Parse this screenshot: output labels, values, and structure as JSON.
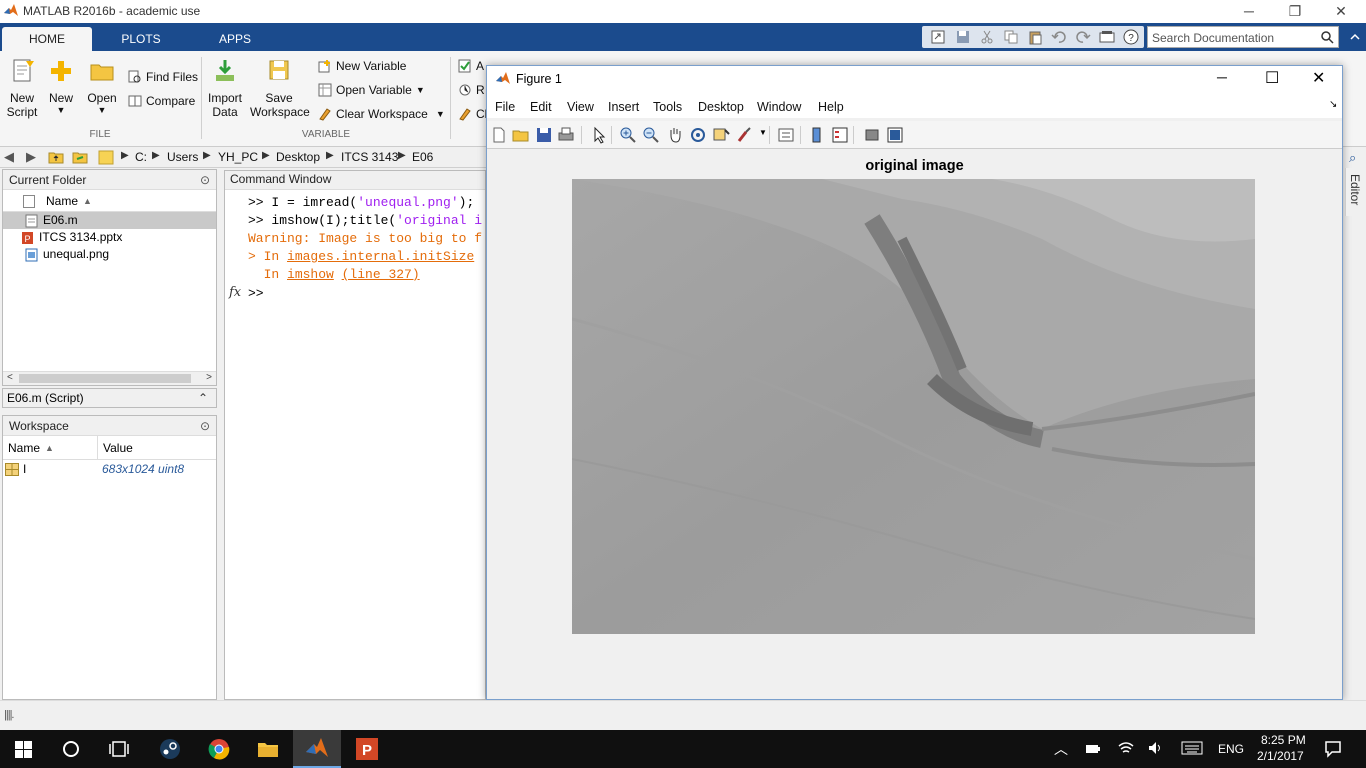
{
  "window": {
    "title": "MATLAB R2016b - academic use",
    "controls": [
      "─",
      "❐",
      "✕"
    ]
  },
  "ribbon": {
    "tabs": [
      "HOME",
      "PLOTS",
      "APPS"
    ],
    "active_tab": "HOME",
    "search_placeholder": "Search Documentation",
    "file_group": {
      "label": "FILE",
      "new_script": [
        "New",
        "Script"
      ],
      "new": "New",
      "open": "Open",
      "find_files": "Find Files",
      "compare": "Compare"
    },
    "variable_group": {
      "label": "VARIABLE",
      "import_data": [
        "Import",
        "Data"
      ],
      "save_workspace": [
        "Save",
        "Workspace"
      ],
      "new_variable": "New Variable",
      "open_variable": "Open Variable",
      "clear_workspace": "Clear Workspace"
    },
    "code_group_partial": [
      "A",
      "R",
      "Cl"
    ]
  },
  "address_bar": {
    "path": [
      "C:",
      "Users",
      "YH_PC",
      "Desktop",
      "ITCS 3143",
      "E06"
    ]
  },
  "current_folder": {
    "title": "Current Folder",
    "column": "Name",
    "files": [
      {
        "name": "E06.m",
        "type": "m",
        "selected": true
      },
      {
        "name": "ITCS 3134.pptx",
        "type": "pptx",
        "selected": false
      },
      {
        "name": "unequal.png",
        "type": "png",
        "selected": false
      }
    ],
    "details_label": "E06.m  (Script)"
  },
  "workspace": {
    "title": "Workspace",
    "columns": [
      "Name",
      "Value"
    ],
    "rows": [
      {
        "name": "I",
        "value": "683x1024 uint8"
      }
    ]
  },
  "command_window": {
    "title": "Command Window",
    "lines": [
      {
        "prompt": ">> ",
        "code": "I = imread(",
        "str": "'unequal.png'",
        "rest": ");"
      },
      {
        "prompt": ">> ",
        "code": "imshow(I);title(",
        "str": "'original i",
        "rest": ""
      },
      {
        "warning": "Warning: Image is too big to f"
      },
      {
        "pre": "> In ",
        "link": "images.internal.initSize"
      },
      {
        "pre": "  In ",
        "link": "imshow",
        "mid": " ",
        "link2": "(line 327)"
      }
    ],
    "fx": "fx",
    "prompt": ">>"
  },
  "figure": {
    "title": "Figure 1",
    "menu": [
      "File",
      "Edit",
      "View",
      "Insert",
      "Tools",
      "Desktop",
      "Window",
      "Help"
    ],
    "axes_title": "original image"
  },
  "side_tab": "Editor",
  "taskbar": {
    "lang": "ENG",
    "time": "8:25 PM",
    "date": "2/1/2017"
  },
  "colors": {
    "ribbon_blue": "#1b4b8d",
    "taskbar": "#101010",
    "string_purple": "#a020f0",
    "warning_orange": "#e46c0a"
  }
}
